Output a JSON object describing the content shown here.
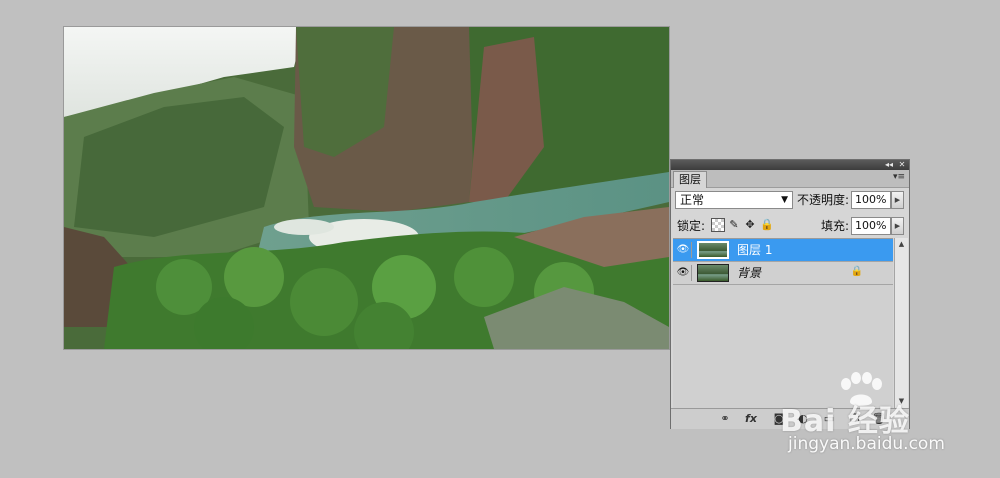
{
  "layers_panel": {
    "tab_label": "图层",
    "titlebar_collapse": "◂◂",
    "titlebar_close": "✕",
    "panel_menu": "▾≡",
    "blend_mode": "正常",
    "opacity_label": "不透明度:",
    "opacity_value": "100%",
    "lock_label": "锁定:",
    "fill_label": "填充:",
    "fill_value": "100%",
    "layers": [
      {
        "name": "图层 1",
        "selected": true
      },
      {
        "name": "背景",
        "selected": false,
        "locked": true
      }
    ],
    "bottom_icons": [
      "link-icon",
      "fx-icon",
      "mask-icon",
      "adjustment-icon",
      "folder-icon",
      "new-layer-icon",
      "trash-icon"
    ],
    "fx_text": "fx"
  },
  "watermark": {
    "brand": "Bai 经验",
    "url": "jingyan.baidu.com"
  },
  "colors": {
    "workspace": "#c0c0c0",
    "panel": "#d6d6d6",
    "selection": "#3a9af0"
  }
}
